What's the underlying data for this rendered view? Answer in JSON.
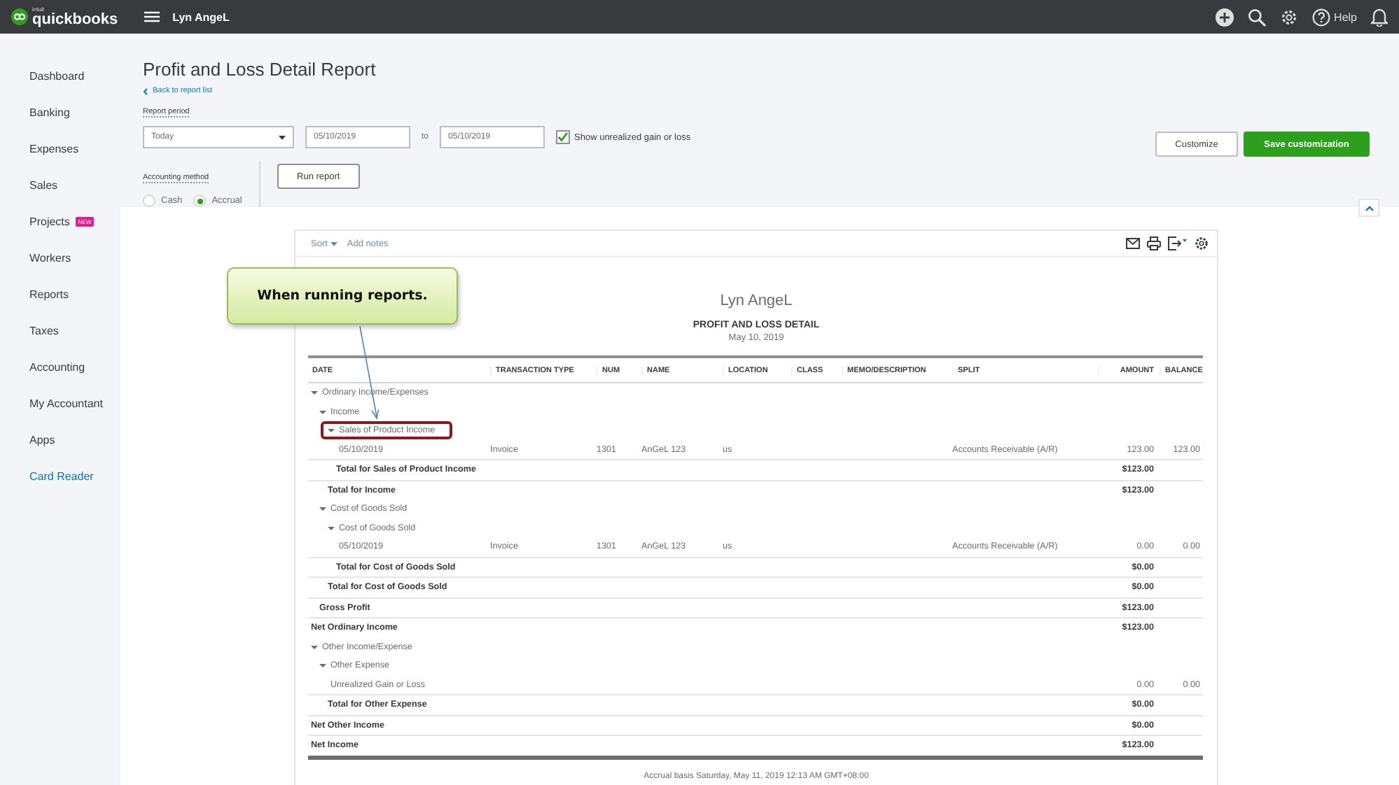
{
  "topbar": {
    "brand_small": "intuit",
    "brand": "quickbooks",
    "company": "Lyn AngeL",
    "help": "Help"
  },
  "sidebar": {
    "items": [
      {
        "label": "Dashboard",
        "kind": "nav"
      },
      {
        "label": "Banking",
        "kind": "nav"
      },
      {
        "label": "Expenses",
        "kind": "nav"
      },
      {
        "label": "Sales",
        "kind": "nav"
      },
      {
        "label": "Projects",
        "kind": "nav",
        "badge": "NEW"
      },
      {
        "label": "Workers",
        "kind": "nav"
      },
      {
        "label": "Reports",
        "kind": "nav"
      },
      {
        "label": "Taxes",
        "kind": "nav"
      },
      {
        "label": "Accounting",
        "kind": "nav"
      },
      {
        "label": "My Accountant",
        "kind": "nav"
      },
      {
        "label": "Apps",
        "kind": "nav"
      },
      {
        "label": "Card Reader",
        "kind": "link"
      }
    ]
  },
  "header": {
    "title": "Profit and Loss Detail Report",
    "back_link": "Back to report list",
    "period_label": "Report period",
    "period": "Today",
    "from": "05/10/2019",
    "to_label": "to",
    "to": "05/10/2019",
    "unrealized": {
      "label": "Show unrealized gain or loss",
      "checked": true
    },
    "method_label": "Accounting method",
    "methods": [
      {
        "label": "Cash",
        "selected": false
      },
      {
        "label": "Accrual",
        "selected": true
      }
    ],
    "run": "Run report",
    "customize": "Customize",
    "save": "Save customization"
  },
  "report": {
    "sort": "Sort",
    "notes": "Add notes",
    "company": "Lyn AngeL",
    "title": "PROFIT AND LOSS DETAIL",
    "date": "May 10, 2019",
    "columns": [
      "DATE",
      "TRANSACTION TYPE",
      "NUM",
      "NAME",
      "LOCATION",
      "CLASS",
      "MEMO/DESCRIPTION",
      "SPLIT",
      "AMOUNT",
      "BALANCE"
    ],
    "rows": [
      {
        "kind": "group",
        "label": "Ordinary Income/Expenses",
        "expanded": true,
        "children": [
          {
            "kind": "group",
            "label": "Income",
            "expanded": true,
            "children": [
              {
                "kind": "group",
                "label": "Sales of Product Income",
                "expanded": true,
                "highlighted": true,
                "children": [
                  {
                    "kind": "txn",
                    "date": "05/10/2019",
                    "type": "Invoice",
                    "num": "1301",
                    "name": "AnGeL 123",
                    "location": "us",
                    "split": "Accounts Receivable (A/R)",
                    "amount": "123.00",
                    "balance": "123.00"
                  },
                  {
                    "kind": "total",
                    "label": "Total for Sales of Product Income",
                    "amount": "$123.00"
                  }
                ]
              },
              {
                "kind": "total",
                "label": "Total for Income",
                "amount": "$123.00"
              }
            ]
          },
          {
            "kind": "group",
            "label": "Cost of Goods Sold",
            "expanded": true,
            "children": [
              {
                "kind": "group",
                "label": "Cost of Goods Sold",
                "expanded": true,
                "children": [
                  {
                    "kind": "txn",
                    "date": "05/10/2019",
                    "type": "Invoice",
                    "num": "1301",
                    "name": "AnGeL 123",
                    "location": "us",
                    "split": "Accounts Receivable (A/R)",
                    "amount": "0.00",
                    "balance": "0.00"
                  },
                  {
                    "kind": "total",
                    "label": "Total for Cost of Goods Sold",
                    "amount": "$0.00"
                  }
                ]
              },
              {
                "kind": "total",
                "label": "Total for Cost of Goods Sold",
                "amount": "$0.00"
              }
            ]
          },
          {
            "kind": "total",
            "label": "Gross Profit",
            "amount": "$123.00"
          }
        ]
      },
      {
        "kind": "total",
        "label": "Net Ordinary Income",
        "amount": "$123.00"
      },
      {
        "kind": "group",
        "label": "Other Income/Expense",
        "expanded": true,
        "children": [
          {
            "kind": "group",
            "label": "Other Expense",
            "expanded": true,
            "children": [
              {
                "kind": "txn",
                "date": "Unrealized Gain or Loss",
                "amount": "0.00",
                "balance": "0.00"
              },
              {
                "kind": "total",
                "label": "Total for Other Expense",
                "amount": "$0.00"
              }
            ]
          }
        ]
      },
      {
        "kind": "total",
        "label": "Net Other Income",
        "amount": "$0.00"
      },
      {
        "kind": "grand",
        "label": "Net Income",
        "amount": "$123.00"
      }
    ],
    "footer": "Accrual basis  Saturday, May 11, 2019  12:13 AM GMT+08:00"
  },
  "callout": {
    "text": "When running reports."
  }
}
